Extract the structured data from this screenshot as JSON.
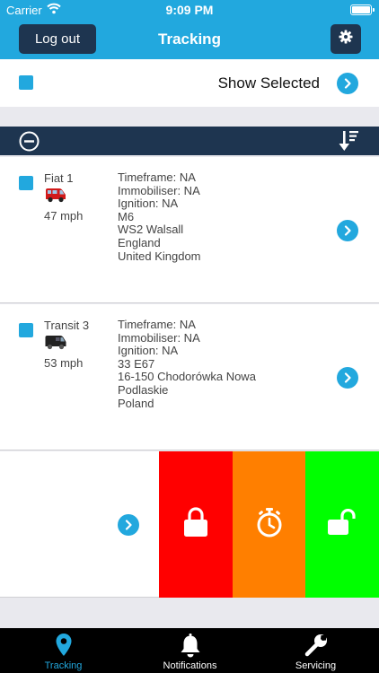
{
  "status_bar": {
    "carrier": "Carrier",
    "time": "9:09 PM"
  },
  "nav": {
    "logout_label": "Log out",
    "title": "Tracking",
    "settings_icon": "gear-icon"
  },
  "show_selected": {
    "label": "Show Selected",
    "checked": true
  },
  "vehicles": [
    {
      "name": "Fiat 1",
      "icon": "red-van-icon",
      "speed": "47 mph",
      "timeframe": "Timeframe: NA",
      "immobiliser": "Immobiliser: NA",
      "ignition": "Ignition: NA",
      "address": [
        "M6",
        "WS2 Walsall",
        "England",
        "United Kingdom"
      ]
    },
    {
      "name": "Transit 3",
      "icon": "black-van-icon",
      "speed": "53 mph",
      "timeframe": "Timeframe: NA",
      "immobiliser": "Immobiliser: NA",
      "ignition": "Ignition: NA",
      "address": [
        "33 E67",
        "16-150 Chodorówka Nowa",
        "Podlaskie",
        "Poland"
      ]
    }
  ],
  "swipe_actions": [
    {
      "name": "lock-icon",
      "color": "#ff0000"
    },
    {
      "name": "timer-icon",
      "color": "#ff7f00"
    },
    {
      "name": "unlock-icon",
      "color": "#00ff00"
    }
  ],
  "tabs": [
    {
      "label": "Tracking",
      "icon": "map-pin-icon",
      "active": true
    },
    {
      "label": "Notifications",
      "icon": "bell-icon",
      "active": false
    },
    {
      "label": "Servicing",
      "icon": "wrench-icon",
      "active": false
    }
  ],
  "colors": {
    "accent": "#22a8de",
    "navy": "#1e3550",
    "lock": "#ff0000",
    "timer": "#ff7f00",
    "unlock": "#00ff00"
  }
}
